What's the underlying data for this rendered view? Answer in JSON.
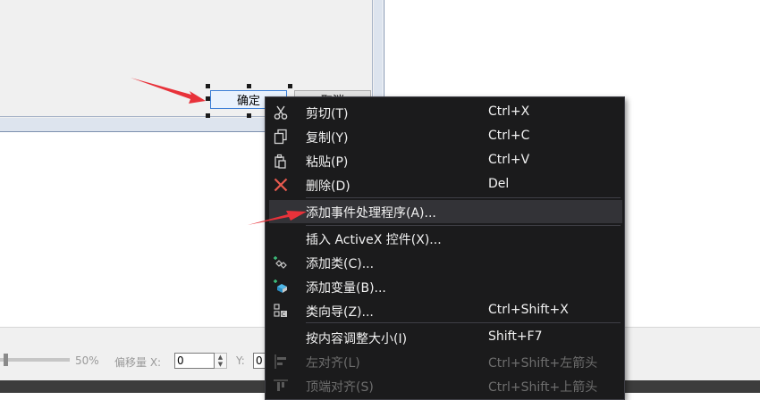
{
  "dialog": {
    "ok_label": "确定",
    "cancel_label": "取消"
  },
  "context_menu": {
    "items": [
      {
        "label": "剪切(T)",
        "shortcut": "Ctrl+X",
        "icon": "scissors-icon"
      },
      {
        "label": "复制(Y)",
        "shortcut": "Ctrl+C",
        "icon": "copy-icon"
      },
      {
        "label": "粘贴(P)",
        "shortcut": "Ctrl+V",
        "icon": "paste-icon"
      },
      {
        "label": "删除(D)",
        "shortcut": "Del",
        "icon": "delete-x-icon"
      },
      {
        "label": "添加事件处理程序(A)...",
        "shortcut": "",
        "icon": ""
      },
      {
        "label": "插入 ActiveX 控件(X)...",
        "shortcut": "",
        "icon": ""
      },
      {
        "label": "添加类(C)...",
        "shortcut": "",
        "icon": "add-class-icon"
      },
      {
        "label": "添加变量(B)...",
        "shortcut": "",
        "icon": "add-variable-icon"
      },
      {
        "label": "类向导(Z)...",
        "shortcut": "Ctrl+Shift+X",
        "icon": "class-wizard-icon"
      },
      {
        "label": "按内容调整大小(I)",
        "shortcut": "Shift+F7",
        "icon": ""
      },
      {
        "label": "左对齐(L)",
        "shortcut": "Ctrl+Shift+左箭头",
        "icon": "align-left-icon"
      },
      {
        "label": "顶端对齐(S)",
        "shortcut": "Ctrl+Shift+上箭头",
        "icon": "align-top-icon"
      }
    ]
  },
  "toolbar": {
    "zoom_label": "50%",
    "offset_label": "偏移量 X:",
    "x_value": "0",
    "y_label": "Y:",
    "y_value": "0"
  },
  "colors": {
    "menu_background": "#1b1b1c",
    "menu_highlight": "#333337",
    "arrow_red": "#e8323a",
    "ok_button_border": "#3c7fd6"
  }
}
